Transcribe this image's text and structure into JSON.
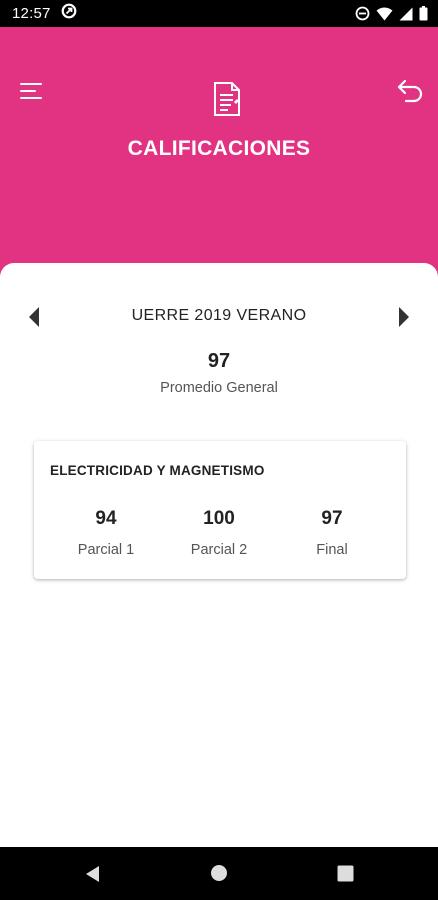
{
  "status_bar": {
    "time": "12:57",
    "icons": [
      "data-saver-icon",
      "do-not-disturb-icon",
      "wifi-icon",
      "cell-signal-icon",
      "battery-icon"
    ]
  },
  "header": {
    "title": "CALIFICACIONES",
    "background_color": "#e23383",
    "icons": [
      "menu-icon",
      "document-icon",
      "undo-back-icon"
    ]
  },
  "period": {
    "label": "UERRE 2019 VERANO"
  },
  "average": {
    "value": "97",
    "label": "Promedio General"
  },
  "subjects": [
    {
      "name": "ELECTRICIDAD Y MAGNETISMO",
      "grades": [
        {
          "value": "94",
          "label": "Parcial 1"
        },
        {
          "value": "100",
          "label": "Parcial 2"
        },
        {
          "value": "97",
          "label": "Final"
        }
      ]
    }
  ],
  "nav_bar": {
    "icons": [
      "nav-back-icon",
      "nav-home-icon",
      "nav-recents-icon"
    ]
  }
}
